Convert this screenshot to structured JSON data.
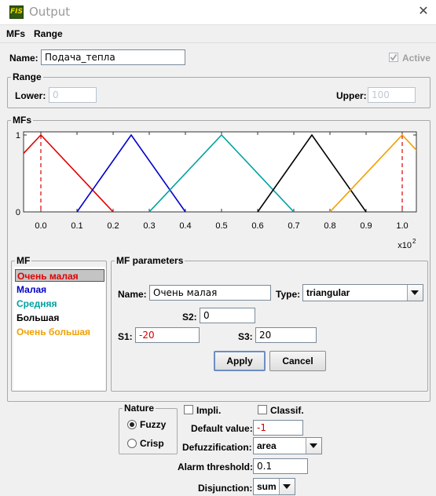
{
  "window": {
    "title": "Output",
    "icon_text": "FIS"
  },
  "menu": {
    "items": [
      "MFs",
      "Range"
    ]
  },
  "name_row": {
    "label": "Name:",
    "value": "Подача_тепла",
    "active_label": "Active",
    "active_checked": true
  },
  "range": {
    "legend": "Range",
    "lower_label": "Lower:",
    "lower_value": "0",
    "upper_label": "Upper:",
    "upper_value": "100"
  },
  "mfs_panel": {
    "legend": "MFs"
  },
  "chart_data": {
    "type": "line",
    "x_ticks": [
      "0.0",
      "0.1",
      "0.2",
      "0.3",
      "0.4",
      "0.5",
      "0.6",
      "0.7",
      "0.8",
      "0.9",
      "1.0"
    ],
    "y_ticks": [
      "0",
      "1"
    ],
    "x_multiplier": "x10",
    "x_multiplier_exp": "2",
    "xlim": [
      0,
      100
    ],
    "ylim": [
      0,
      1
    ],
    "series": [
      {
        "color": "#e00000",
        "points": [
          [
            -20,
            0
          ],
          [
            0,
            1
          ],
          [
            20,
            0
          ]
        ]
      },
      {
        "color": "#0000cc",
        "points": [
          [
            10,
            0
          ],
          [
            25,
            1
          ],
          [
            40,
            0
          ]
        ]
      },
      {
        "color": "#00a0a0",
        "points": [
          [
            30,
            0
          ],
          [
            50,
            1
          ],
          [
            70,
            0
          ]
        ]
      },
      {
        "color": "#000000",
        "points": [
          [
            60,
            0
          ],
          [
            75,
            1
          ],
          [
            90,
            0
          ]
        ]
      },
      {
        "color": "#f0a000",
        "points": [
          [
            80,
            0
          ],
          [
            100,
            1
          ],
          [
            120,
            0
          ]
        ]
      }
    ],
    "marked_peaks": [
      0,
      100
    ],
    "marked_color": "#e00000"
  },
  "mf_list": {
    "legend": "MF",
    "items": [
      {
        "label": "Очень малая",
        "color": "#e00000",
        "selected": true
      },
      {
        "label": "Малая",
        "color": "#0000cc",
        "selected": false
      },
      {
        "label": "Средняя",
        "color": "#00a0a0",
        "selected": false
      },
      {
        "label": "Большая",
        "color": "#000000",
        "selected": false
      },
      {
        "label": "Очень большая",
        "color": "#f0a000",
        "selected": false
      }
    ]
  },
  "mf_params": {
    "legend": "MF parameters",
    "name_label": "Name:",
    "name_value": "Очень малая",
    "type_label": "Type:",
    "type_value": "triangular",
    "s2_label": "S2:",
    "s2_value": "0",
    "s1_label": "S1:",
    "s1_value": "-20",
    "s3_label": "S3:",
    "s3_value": "20",
    "apply_label": "Apply",
    "cancel_label": "Cancel"
  },
  "nature": {
    "legend": "Nature",
    "fuzzy_label": "Fuzzy",
    "crisp_label": "Crisp",
    "selected": "Fuzzy"
  },
  "options": {
    "impli_label": "Impli.",
    "classif_label": "Classif.",
    "default_value_label": "Default value:",
    "default_value": "-1",
    "defuzz_label": "Defuzzification:",
    "defuzz_value": "area",
    "alarm_label": "Alarm threshold:",
    "alarm_value": "0.1",
    "disjunction_label": "Disjunction:",
    "disjunction_value": "sum"
  }
}
